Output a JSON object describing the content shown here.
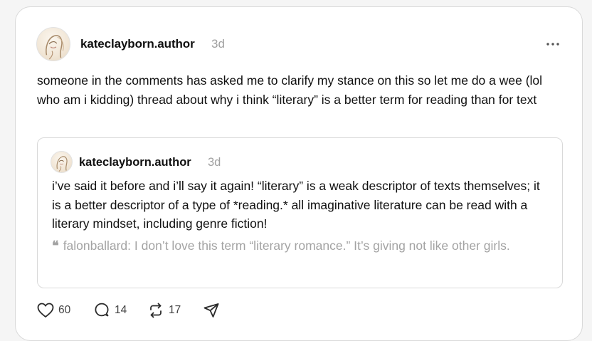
{
  "post": {
    "author": "kateclayborn.author",
    "time": "3d",
    "text": "someone in the comments has asked me to clarify my stance on this so let me do a wee (lol who am i kidding) thread about why i think “literary” is a better term for reading than for text"
  },
  "quoted_post": {
    "author": "kateclayborn.author",
    "time": "3d",
    "text": "i’ve said it before and i’ll say it again! “literary” is a weak descriptor of texts themselves; it is a better descriptor of a type of *reading.* all imaginative literature can be read with a literary mindset, including genre fiction!",
    "nested_quote": "falonballard: I don’t love this term “literary romance.” It’s giving not like other girls.",
    "nested_quote_icon": "quote-mark-icon"
  },
  "actions": {
    "likes": "60",
    "replies": "14",
    "reposts": "17",
    "icons": [
      "heart-icon",
      "comment-icon",
      "repost-icon",
      "share-icon"
    ]
  },
  "colors": {
    "text": "#101010",
    "muted": "#a0a0a0",
    "border": "#d9d9d9",
    "background": "#f5f5f5",
    "card": "#ffffff"
  }
}
